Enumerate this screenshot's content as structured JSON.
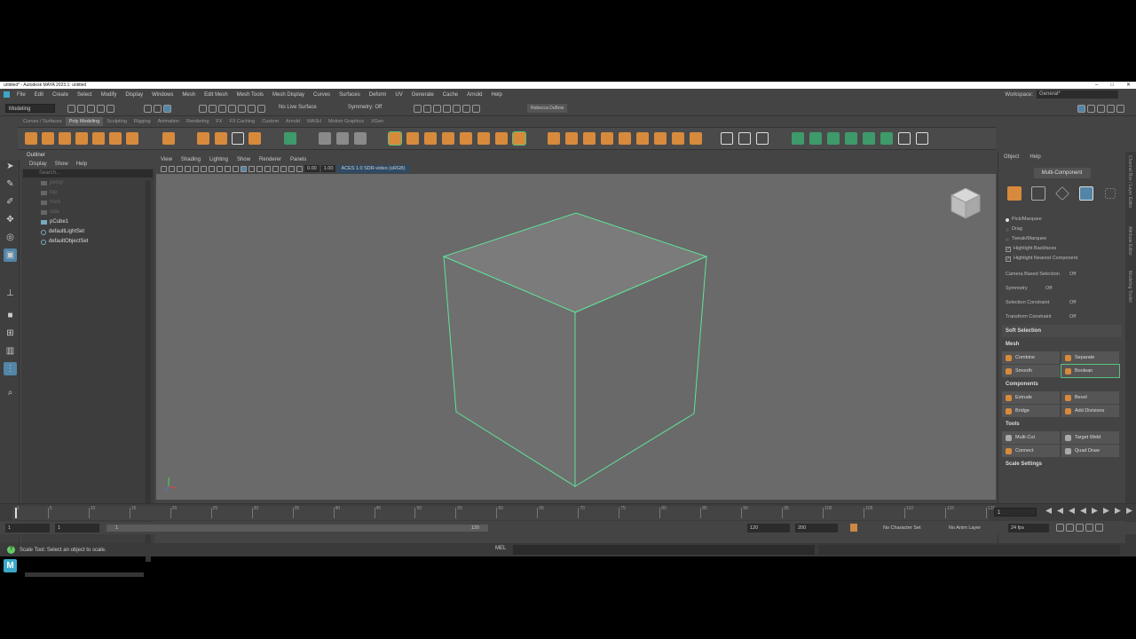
{
  "window": {
    "title": "untitled* - Autodesk MAYA 2023.1: untitled"
  },
  "menus": [
    "File",
    "Edit",
    "Create",
    "Select",
    "Modify",
    "Display",
    "Windows",
    "Mesh",
    "Edit Mesh",
    "Mesh Tools",
    "Mesh Display",
    "Curves",
    "Surfaces",
    "Deform",
    "UV",
    "Generate",
    "Cache",
    "Arnold",
    "Help"
  ],
  "workspace": {
    "label": "Workspace:",
    "value": "General*"
  },
  "statusline": {
    "mode": "Modeling",
    "live": "No Live Surface",
    "symmetry": "Symmetry: Off",
    "user": "Rebecca DuBois"
  },
  "shelf_tabs": [
    "Curves / Surfaces",
    "Poly Modeling",
    "Sculpting",
    "Rigging",
    "Animation",
    "Rendering",
    "FX",
    "FX Caching",
    "Custom",
    "Arnold",
    "MASH",
    "Motion Graphics",
    "XGen"
  ],
  "shelf_active": "Poly Modeling",
  "outliner": {
    "title": "Outliner",
    "menu": [
      "Display",
      "Show",
      "Help"
    ],
    "search_placeholder": "Search...",
    "items": [
      {
        "label": "persp",
        "dim": true
      },
      {
        "label": "top",
        "dim": true
      },
      {
        "label": "front",
        "dim": true
      },
      {
        "label": "side",
        "dim": true
      },
      {
        "label": "pCube1",
        "dim": false
      },
      {
        "label": "defaultLightSet",
        "dim": false
      },
      {
        "label": "defaultObjectSet",
        "dim": false
      }
    ]
  },
  "panel_menu": [
    "View",
    "Shading",
    "Lighting",
    "Show",
    "Renderer",
    "Panels"
  ],
  "panel_tools": {
    "exposure": "0.00",
    "gamma": "1.00",
    "colorspace": "ACES 1.0 SDR-video (sRGB)"
  },
  "modeling_toolkit": {
    "menu": [
      "Object",
      "Help"
    ],
    "mode": "Multi-Component",
    "selection_options": {
      "pick": "Pick/Marquee",
      "drag": "Drag",
      "tweak": "Tweak/Marquee",
      "backfaces": "Highlight Backfaces",
      "nearest": "Highlight Nearest Component"
    },
    "props": [
      {
        "k": "Camera Based Selection",
        "v": "Off"
      },
      {
        "k": "Symmetry",
        "v": "Off"
      },
      {
        "k": "Selection Constraint",
        "v": "Off"
      },
      {
        "k": "Transform Constraint",
        "v": "Off"
      }
    ],
    "soft_selection": "Soft Selection",
    "mesh": {
      "title": "Mesh",
      "buttons": [
        "Combine",
        "Separate",
        "Smooth",
        "Boolean"
      ]
    },
    "components": {
      "title": "Components",
      "buttons": [
        "Extrude",
        "Bevel",
        "Bridge",
        "Add Divisions"
      ]
    },
    "tools": {
      "title": "Tools",
      "buttons": [
        "Multi-Cut",
        "Target Weld",
        "Connect",
        "Quad Draw"
      ]
    },
    "scale_settings": "Scale Settings"
  },
  "right_strip": [
    "Channel Box / Layer Editor",
    "Attribute Editor",
    "Modeling Toolkit"
  ],
  "timeline": {
    "ticks": [
      1,
      5,
      10,
      15,
      20,
      25,
      30,
      35,
      40,
      45,
      50,
      55,
      60,
      65,
      70,
      75,
      80,
      85,
      90,
      95,
      100,
      105,
      110,
      115,
      120
    ],
    "current": "1"
  },
  "range": {
    "start": "1",
    "inner_start": "1",
    "slider_start": "1",
    "slider_end": "120",
    "end": "120",
    "anim_end": "200",
    "character": "No Character Set",
    "anim_layer": "No Anim Layer",
    "fps": "24 fps"
  },
  "command_line": {
    "help": "Scale Tool: Select an object to scale.",
    "lang": "MEL"
  },
  "colors": {
    "accent": "#5285a6",
    "selection": "#57c27a",
    "shelf_icon": "#d88a3c"
  }
}
